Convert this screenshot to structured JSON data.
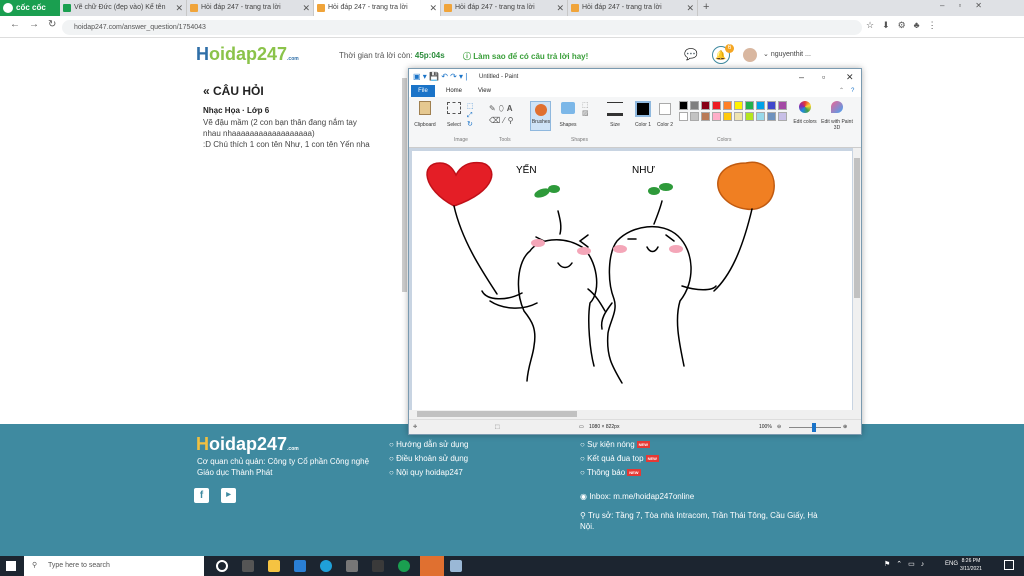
{
  "browser": {
    "brand": "cốc cốc",
    "tabs": [
      {
        "label": "Vẽ chữ Đức (đẹp vào) Kể tên"
      },
      {
        "label": "Hỏi đáp 247 - trang tra lời"
      },
      {
        "label": "Hỏi đáp 247 - trang tra lời"
      },
      {
        "label": "Hỏi đáp 247 - trang tra lời"
      },
      {
        "label": "Hỏi đáp 247 - trang tra lời"
      }
    ],
    "url": "hoidap247.com/answer_question/1754043"
  },
  "site": {
    "logo_h": "H",
    "logo_rest": "oidap247",
    "logo_sub": ".com",
    "timer_label": "Thời gian trả lời còn:",
    "timer_value": "45p:04s",
    "help_text": "Làm sao để có câu trả lời hay!",
    "notif_count": "6",
    "username": "nguyenthit ..."
  },
  "question": {
    "title": "CÂU HỎI",
    "subject": "Nhạc Họa · Lớp 6",
    "line1": "Vẽ đậu mầm (2 con bạn thân đang nắm tay",
    "line2": "nhau nhaaaaaaaaaaaaaaaaaa)",
    "line3": ":D Chú thích 1 con tên Như, 1 con tên Yến nha"
  },
  "paint": {
    "title": "Untitled - Paint",
    "menu": {
      "file": "File",
      "home": "Home",
      "view": "View"
    },
    "groups": {
      "image": "Image",
      "tools": "Tools",
      "shapes": "Shapes",
      "colors": "Colors"
    },
    "tools": {
      "clipboard": "Clipboard",
      "select": "Select",
      "brushes": "Brushes",
      "shapes": "Shapes",
      "size": "Size",
      "color1": "Color 1",
      "color2": "Color 2",
      "edit_colors": "Edit colors",
      "edit_3d": "Edit with Paint 3D"
    },
    "palette": [
      "#000000",
      "#7f7f7f",
      "#880015",
      "#ed1c24",
      "#ff7f27",
      "#fff200",
      "#22b14c",
      "#00a2e8",
      "#3f48cc",
      "#a349a4",
      "#ffffff",
      "#c3c3c3",
      "#b97a57",
      "#ffaec9",
      "#ffc90e",
      "#efe4b0",
      "#b5e61d",
      "#99d9ea",
      "#7092be",
      "#c8bfe7"
    ],
    "drawing": {
      "label_left": "YẾN",
      "label_right": "NHƯ"
    },
    "status_size": "1080 × 822px",
    "zoom": "100%"
  },
  "footer": {
    "company": "Cơ quan chủ quản: Công ty Cổ phần Công nghệ",
    "company2": "Giáo dục Thành Phát",
    "links1": [
      "Hướng dẫn sử dụng",
      "Điều khoản sử dụng",
      "Nội quy hoidap247"
    ],
    "links2": [
      "Sự kiện nóng",
      "Kết quả đua top",
      "Thông báo"
    ],
    "new_badge": "NEW",
    "inbox": "Inbox: m.me/hoidap247online",
    "address": "Trụ sở: Tầng 7, Tòa nhà Intracom, Trần Thái Tông, Cầu Giấy, Hà",
    "address2": "Nội."
  },
  "taskbar": {
    "search_placeholder": "Type here to search",
    "lang": "ENG",
    "time": "8:26 PM",
    "date": "3/11/2021"
  }
}
